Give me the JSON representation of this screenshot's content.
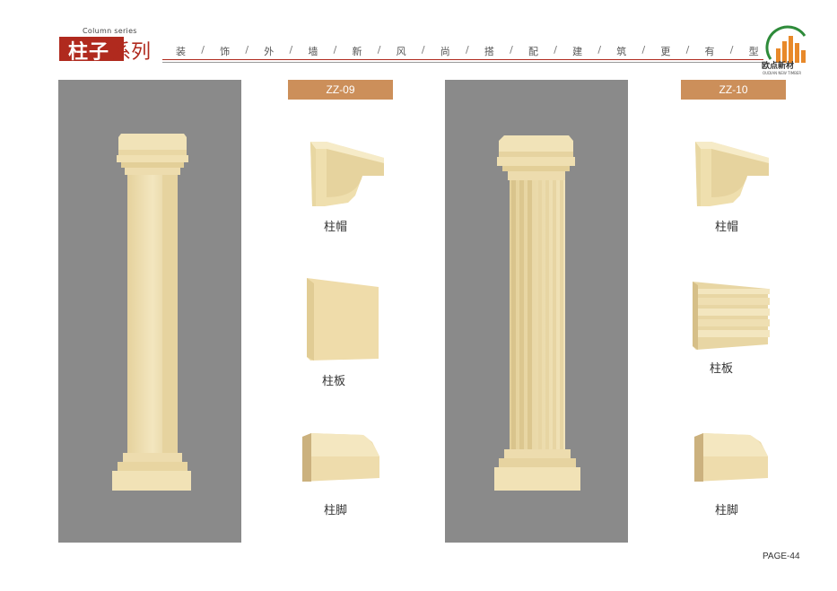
{
  "header": {
    "title_en": "Column series",
    "title_zh_bold": "柱子",
    "title_zh_light": "系列",
    "tagline_chars": [
      "装",
      "饰",
      "外",
      "墙",
      "新",
      "风",
      "尚",
      "搭",
      "配",
      "建",
      "筑",
      "更",
      "有",
      "型"
    ],
    "tagline_separator": "/",
    "logo_text": "欧点新材",
    "logo_subtext": "OUDIAN NEW TIMBER"
  },
  "products": [
    {
      "model": "ZZ-09",
      "parts": [
        {
          "label": "柱帽",
          "icon": "column-cap-icon"
        },
        {
          "label": "柱板",
          "icon": "column-panel-icon"
        },
        {
          "label": "柱脚",
          "icon": "column-base-icon"
        }
      ]
    },
    {
      "model": "ZZ-10",
      "parts": [
        {
          "label": "柱帽",
          "icon": "column-cap-icon"
        },
        {
          "label": "柱板",
          "icon": "column-panel-fluted-icon"
        },
        {
          "label": "柱脚",
          "icon": "column-base-icon"
        }
      ]
    }
  ],
  "colors": {
    "brand_red": "#b02a1e",
    "tag_orange": "#cc8f5a",
    "panel_gray": "#8a8a8a",
    "cream": "#efdfae"
  },
  "footer": {
    "page_label": "PAGE-44"
  }
}
